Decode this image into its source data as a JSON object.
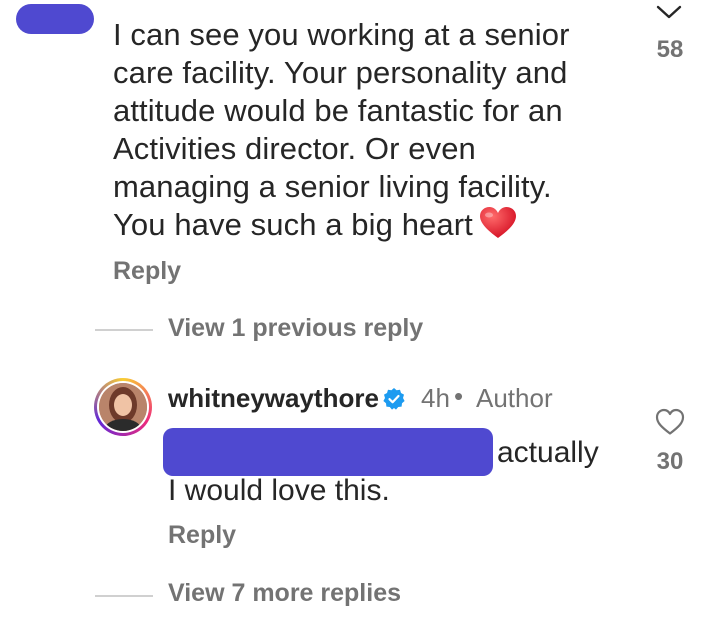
{
  "parent_comment": {
    "text_lines": [
      "I can see you working at a senior",
      "care facility. Your personality and",
      "attitude would be fantastic for an",
      "Activities director. Or even",
      "managing a senior living facility.",
      "You have such a big heart"
    ],
    "emoji": "red-heart",
    "like_count": "58",
    "reply_label": "Reply"
  },
  "thread": {
    "view_previous_label": "View 1 previous reply",
    "view_more_label": "View 7 more replies"
  },
  "reply_comment": {
    "username": "whitneywaythore",
    "verified": true,
    "time": "4h",
    "separator": "•",
    "role": "Author",
    "text_after_redaction": "actually",
    "text_line_2": "I would love this.",
    "like_count": "30",
    "reply_label": "Reply"
  },
  "colors": {
    "redaction": "#4f49d0",
    "secondary_text": "#737373",
    "verified_blue": "#1d9bf0",
    "heart_red": "#e8192c"
  }
}
